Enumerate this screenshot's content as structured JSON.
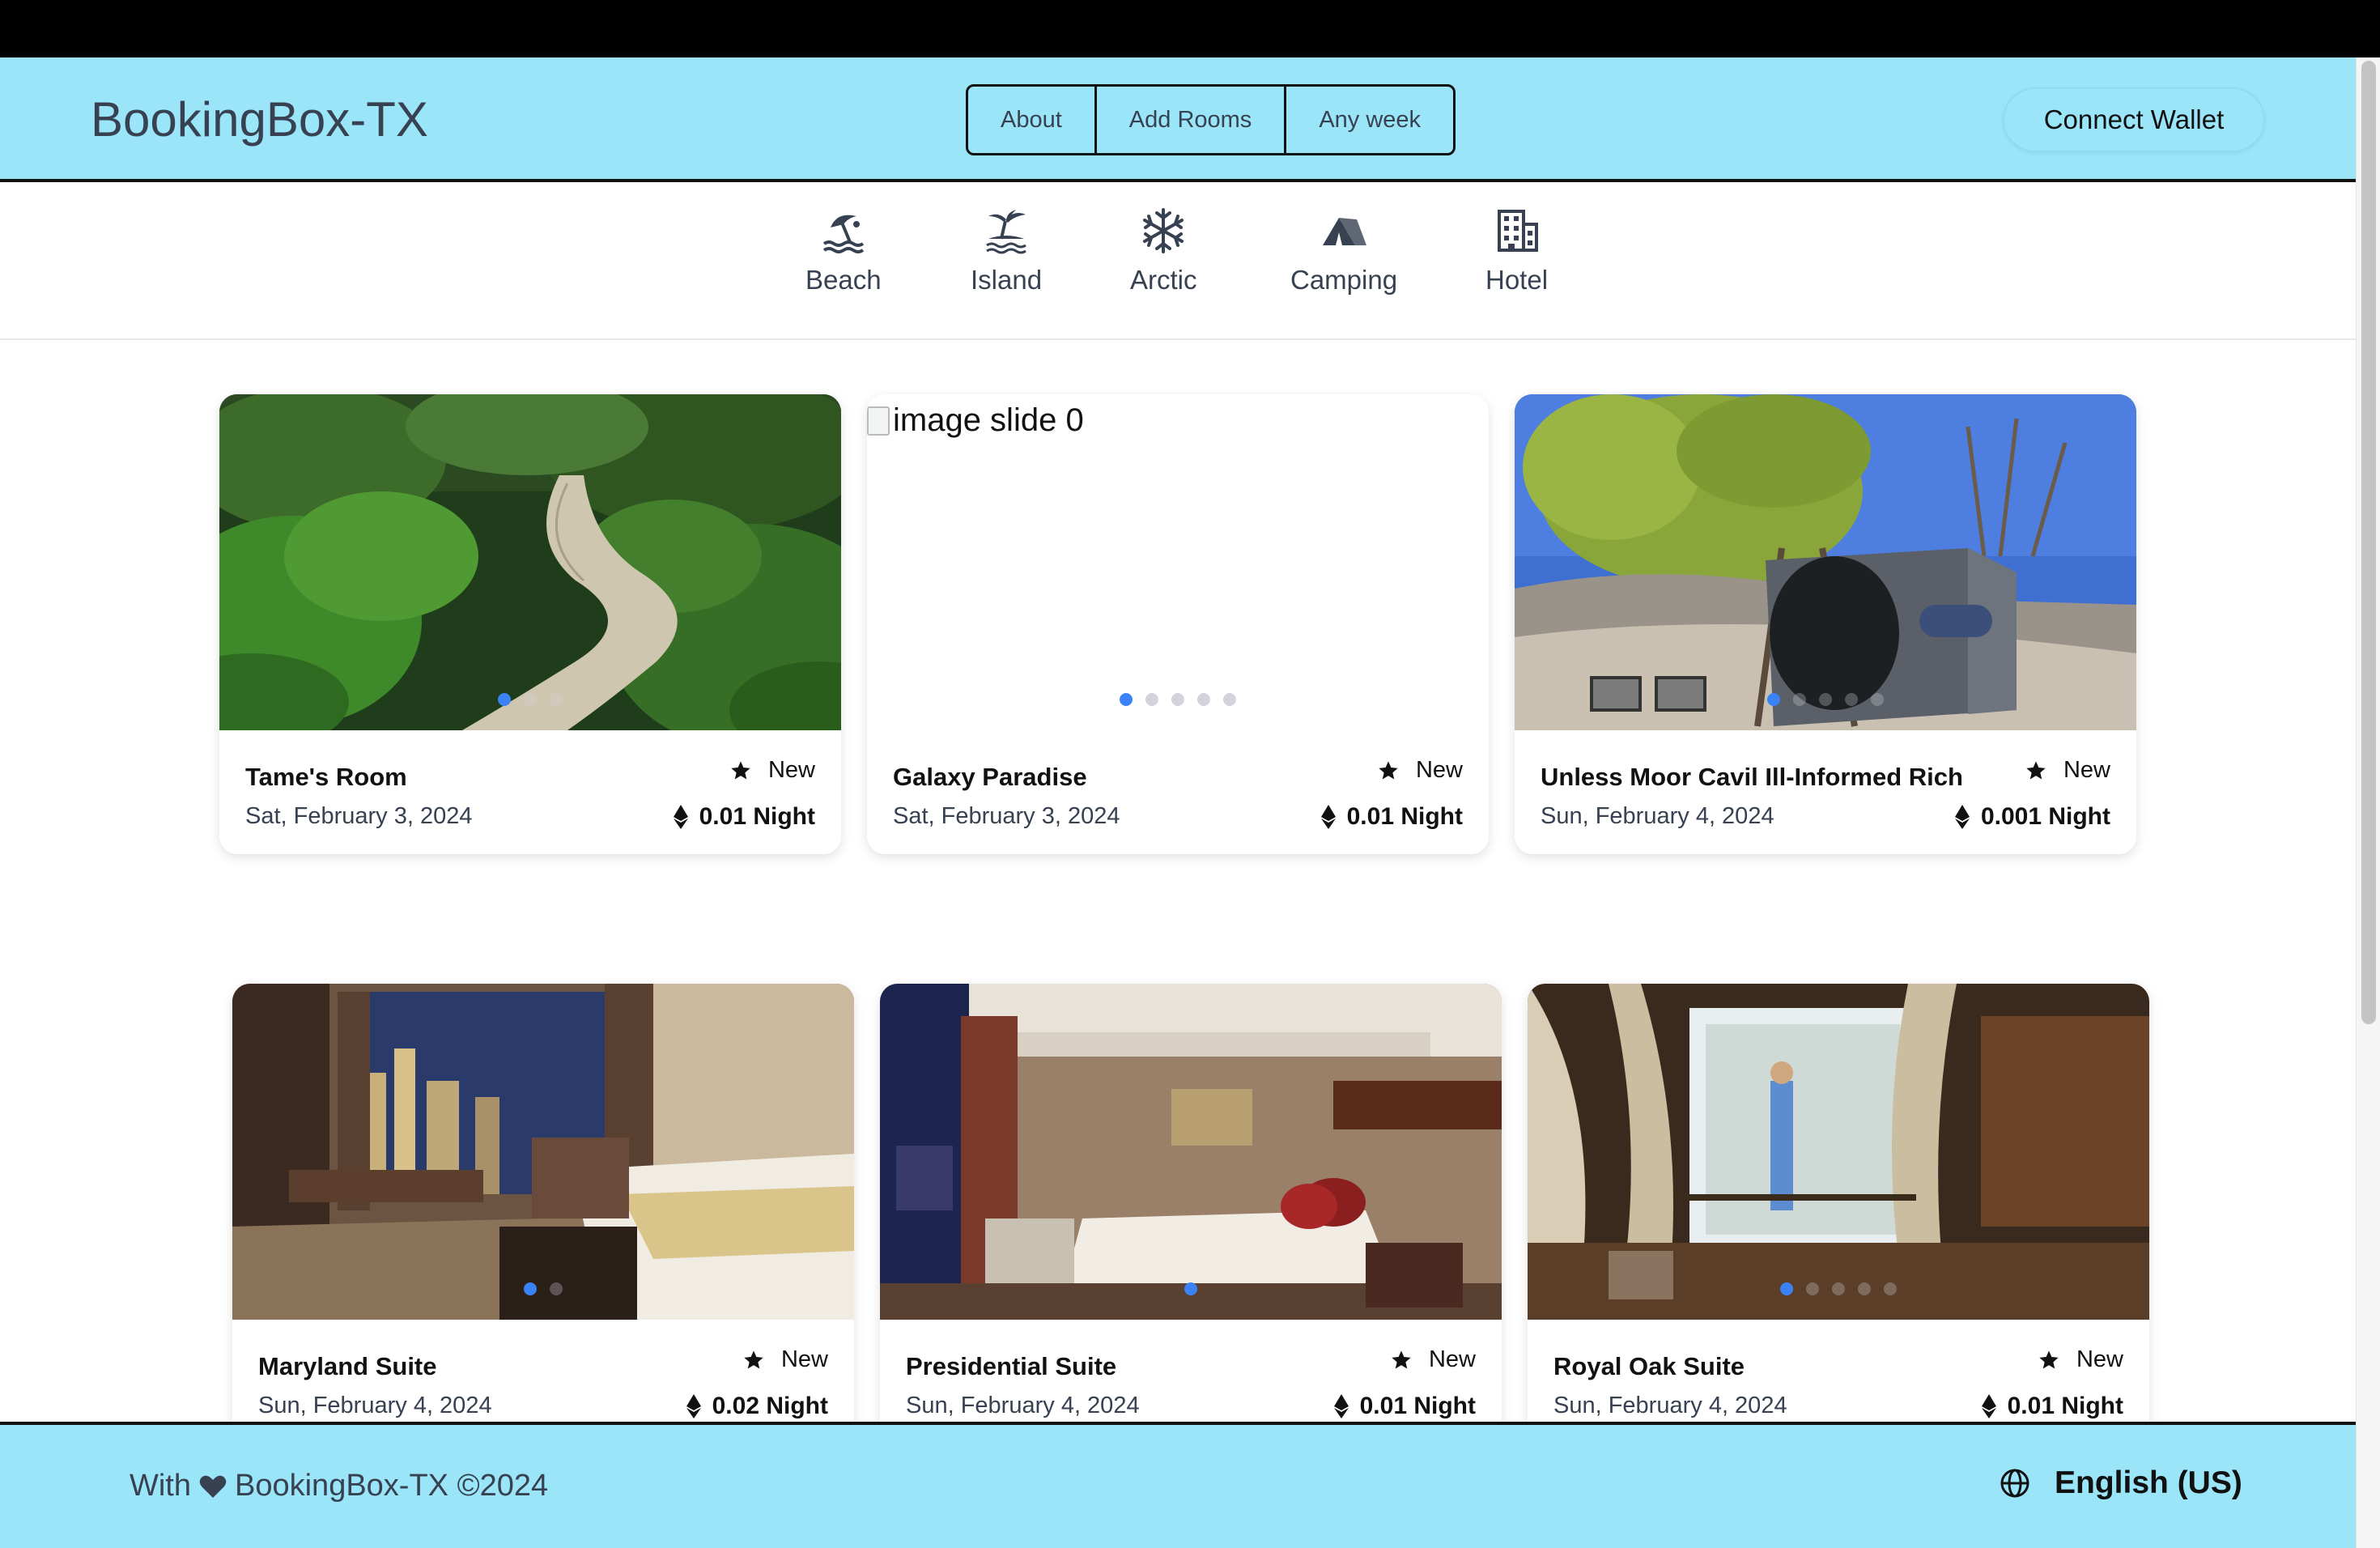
{
  "header": {
    "brand": "BookingBox-TX",
    "nav": [
      "About",
      "Add Rooms",
      "Any week"
    ],
    "connect_label": "Connect Wallet"
  },
  "categories": [
    {
      "label": "Beach",
      "icon": "beach-umbrella-icon"
    },
    {
      "label": "Island",
      "icon": "palm-island-icon"
    },
    {
      "label": "Arctic",
      "icon": "snowflake-icon"
    },
    {
      "label": "Camping",
      "icon": "tent-icon"
    },
    {
      "label": "Hotel",
      "icon": "building-icon"
    }
  ],
  "listings": [
    {
      "title": "Tame's Room",
      "date": "Sat, February 3, 2024",
      "badge": "New",
      "price": "0.01 Night",
      "slides": 3,
      "active_slide": 0
    },
    {
      "title": "Galaxy Paradise",
      "date": "Sat, February 3, 2024",
      "badge": "New",
      "price": "0.01 Night",
      "broken_alt": "image slide 0",
      "slides": 5,
      "active_slide": 0
    },
    {
      "title": "Unless Moor Cavil Ill-Informed Rich",
      "date": "Sun, February 4, 2024",
      "badge": "New",
      "price": "0.001 Night",
      "slides": 5,
      "active_slide": 0
    },
    {
      "title": "Maryland Suite",
      "date": "Sun, February 4, 2024",
      "badge": "New",
      "price": "0.02 Night",
      "slides": 2,
      "active_slide": 0
    },
    {
      "title": "Presidential Suite",
      "date": "Sun, February 4, 2024",
      "badge": "New",
      "price": "0.01 Night",
      "slides": 1,
      "active_slide": 0
    },
    {
      "title": "Royal Oak Suite",
      "date": "Sun, February 4, 2024",
      "badge": "New",
      "price": "0.01 Night",
      "slides": 5,
      "active_slide": 0
    }
  ],
  "footer": {
    "left": "With ❤ BookingBox-TX ©2024",
    "with": "With",
    "copyright": "BookingBox-TX ©2024",
    "language": "English (US)"
  },
  "colors": {
    "header_bg": "#9ae6f8",
    "dot_active": "#3b82f6",
    "dot_inactive": "#d1d5db"
  }
}
